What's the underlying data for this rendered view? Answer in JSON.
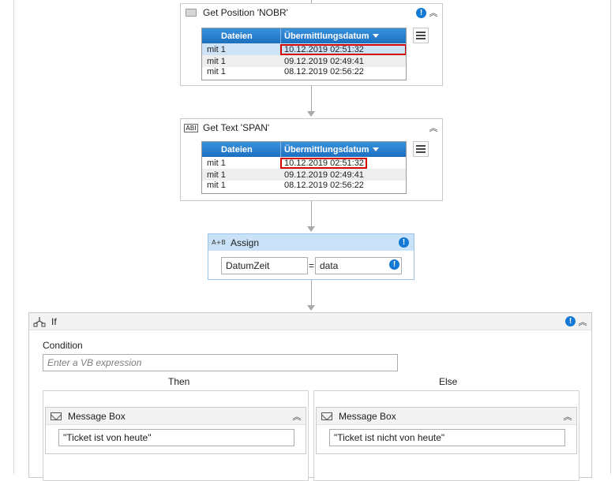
{
  "get_position": {
    "title": "Get Position 'NOBR'",
    "icon": "screen-region-icon",
    "table": {
      "columns": [
        "Dateien",
        "Übermittlungsdatum"
      ],
      "rows": [
        {
          "col1": "mit 1",
          "col2": "10.12.2019 02:51:32"
        },
        {
          "col1": "mit 1",
          "col2": "09.12.2019 02:49:41"
        },
        {
          "col1": "mit 1",
          "col2": "08.12.2019 02:56:22"
        }
      ]
    }
  },
  "get_text": {
    "title": "Get Text 'SPAN'",
    "icon": "text-field-icon",
    "icon_label": "ABI",
    "table": {
      "columns": [
        "Dateien",
        "Übermittlungsdatum"
      ],
      "rows": [
        {
          "col1": "mit 1",
          "col2": "10.12.2019 02:51:32"
        },
        {
          "col1": "mit 1",
          "col2": "09.12.2019 02:49:41"
        },
        {
          "col1": "mit 1",
          "col2": "08.12.2019 02:56:22"
        }
      ]
    }
  },
  "assign": {
    "title": "Assign",
    "icon_label": "A+B",
    "to": "DatumZeit",
    "equals": "=",
    "value": "data"
  },
  "if_activity": {
    "title": "If",
    "condition_label": "Condition",
    "condition_placeholder": "Enter a VB expression",
    "then_label": "Then",
    "else_label": "Else",
    "then_message": {
      "title": "Message Box",
      "text": "\"Ticket ist von heute\""
    },
    "else_message": {
      "title": "Message Box",
      "text": "\"Ticket ist nicht von heute\""
    }
  },
  "colors": {
    "accent": "#1379d4",
    "header_blue": "#1b6fc0",
    "highlight_red": "#d40000",
    "assign_header": "#c9e2f7"
  }
}
